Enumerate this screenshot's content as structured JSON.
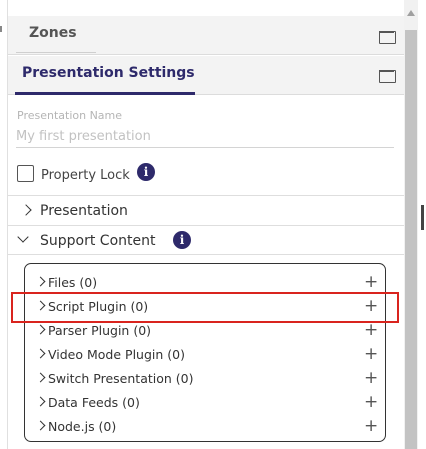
{
  "zones_panel": {
    "title": "Zones"
  },
  "presentation_settings_panel": {
    "title": "Presentation Settings"
  },
  "presentation_name": {
    "label": "Presentation Name",
    "placeholder": "My first presentation",
    "value": ""
  },
  "property_lock": {
    "label": "Property Lock",
    "checked": false
  },
  "sections": {
    "presentation": {
      "label": "Presentation",
      "expanded": false
    },
    "support_content": {
      "label": "Support Content",
      "expanded": true
    }
  },
  "support_items": [
    {
      "label": "Files (0)",
      "plus": "+"
    },
    {
      "label": "Script Plugin (0)",
      "plus": "+"
    },
    {
      "label": "Parser Plugin (0)",
      "plus": "+"
    },
    {
      "label": "Video Mode Plugin (0)",
      "plus": "+"
    },
    {
      "label": "Switch Presentation (0)",
      "plus": "+"
    },
    {
      "label": "Data Feeds (0)",
      "plus": "+"
    },
    {
      "label": "Node.js (0)",
      "plus": "+"
    }
  ],
  "icons": {
    "info": "i",
    "info_color": "#2e2a6b",
    "highlight_color": "#d9241e"
  }
}
